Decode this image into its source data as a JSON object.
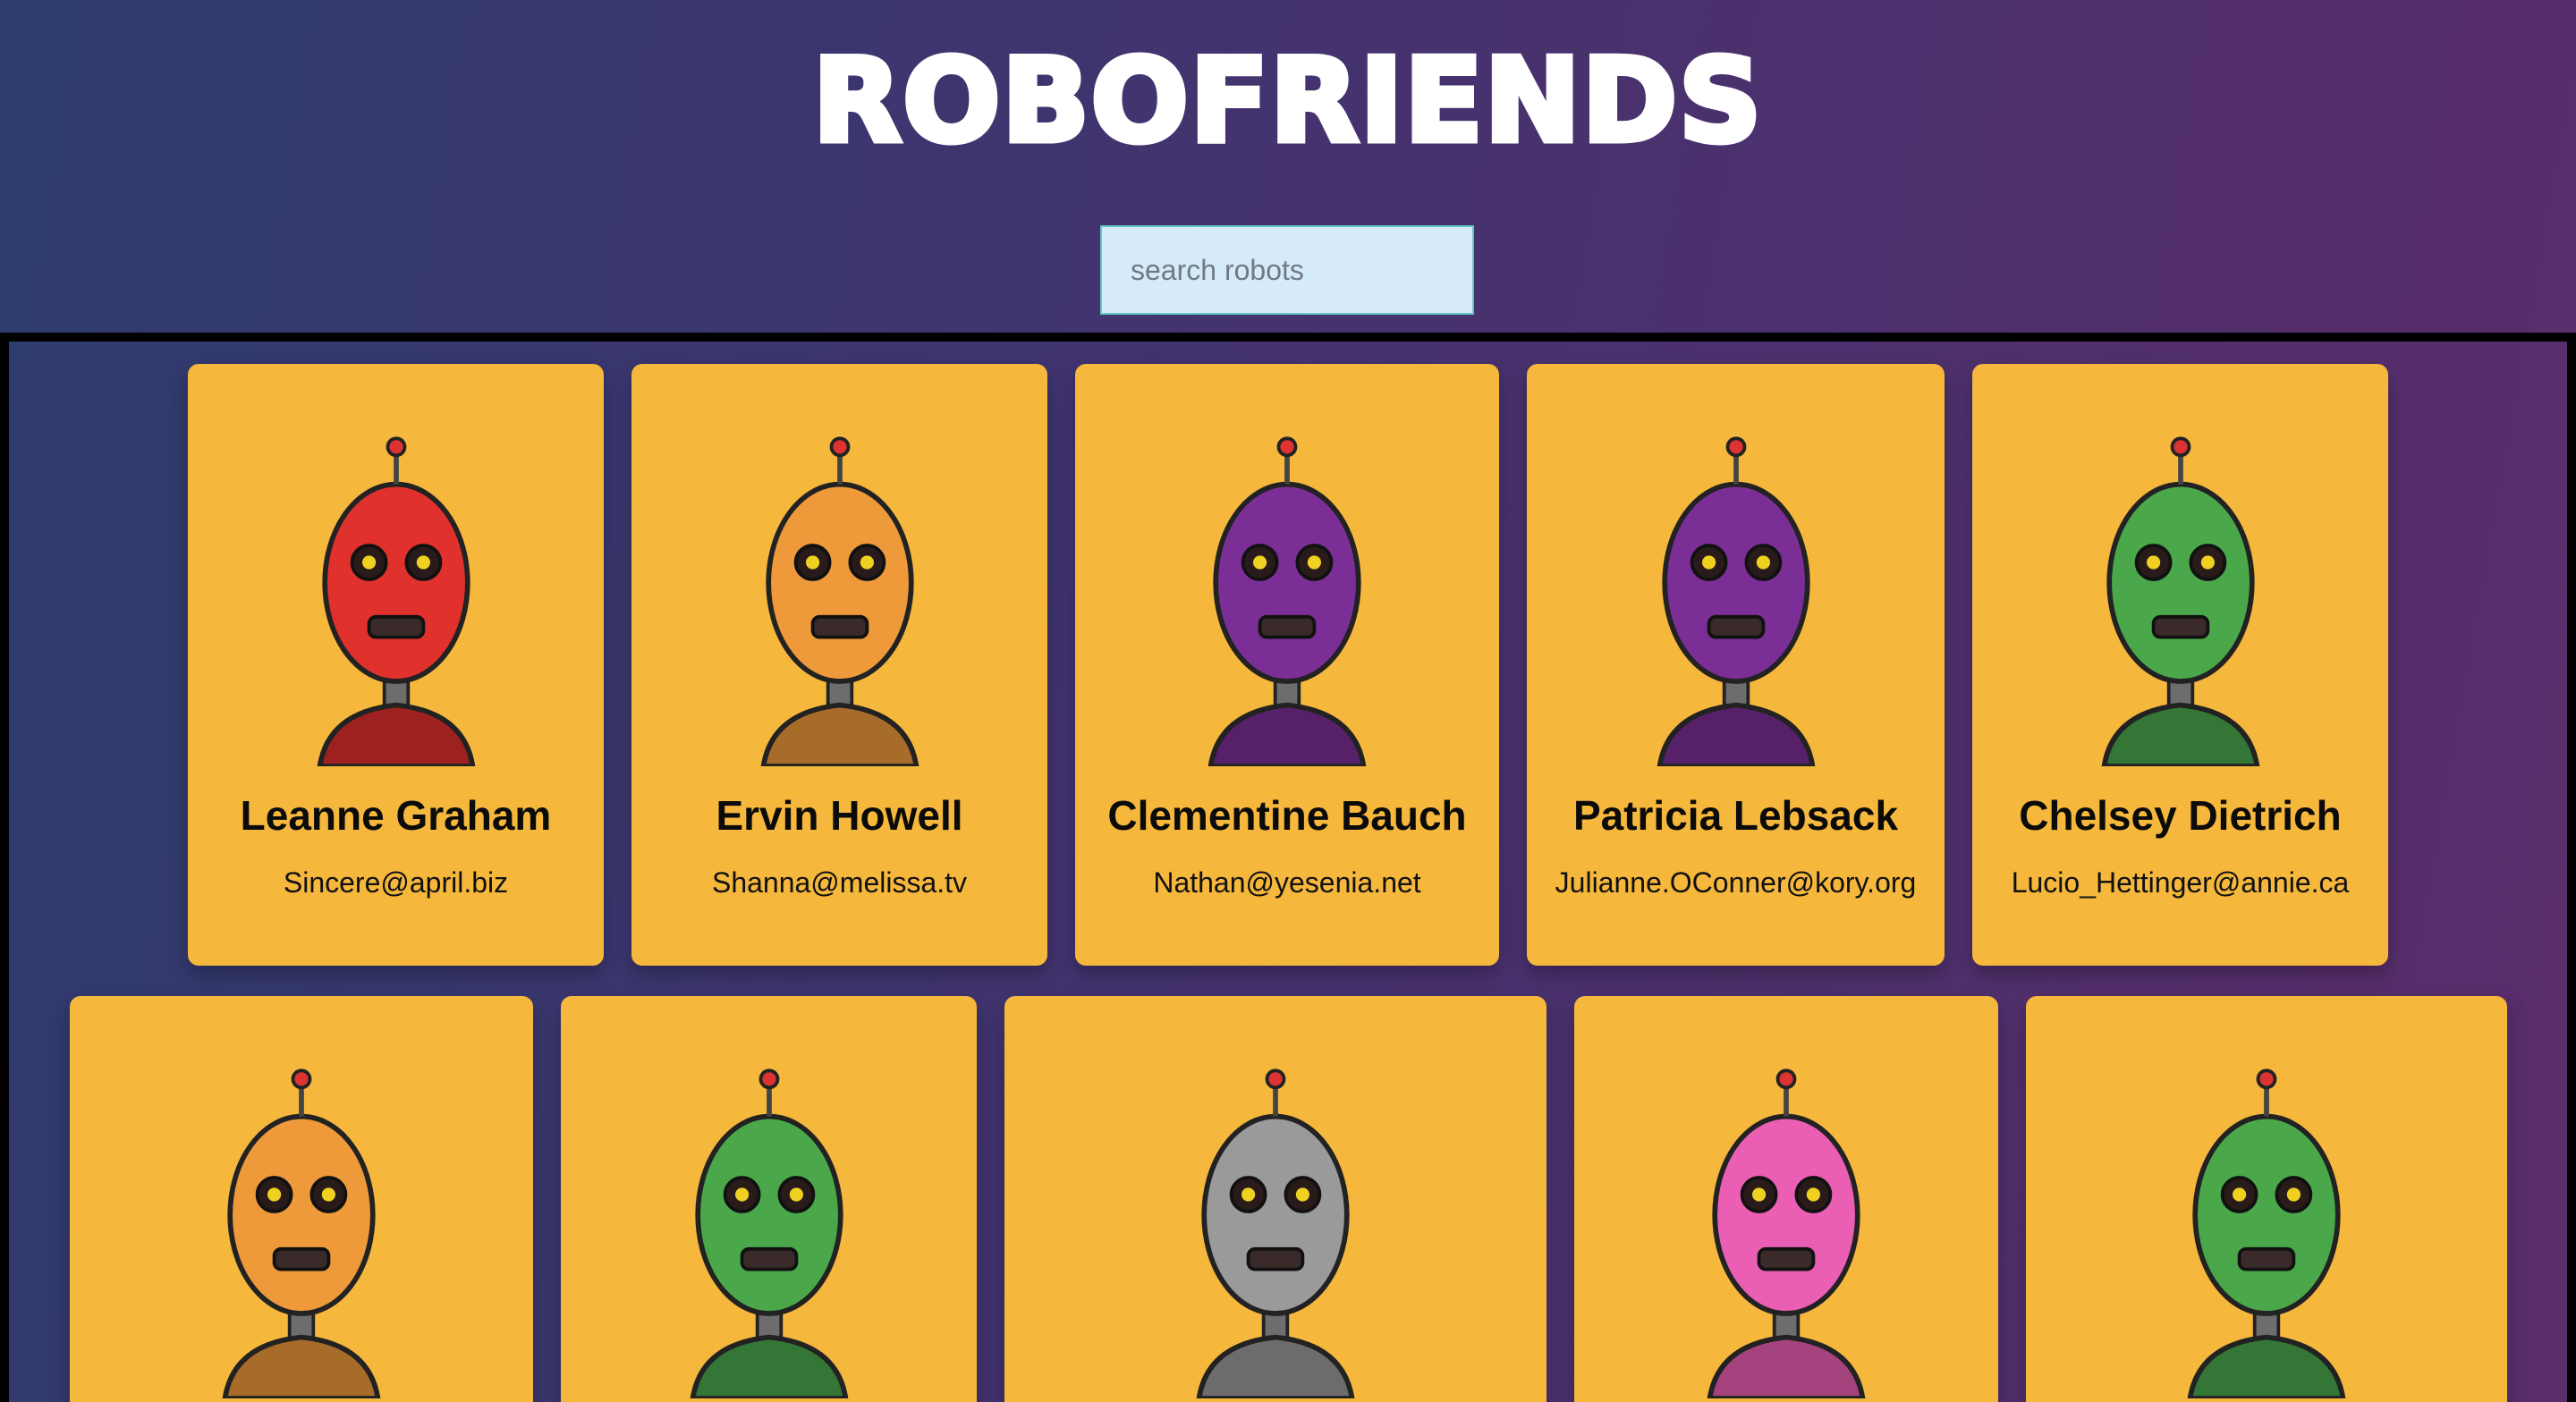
{
  "app": {
    "title": "ROBOFRIENDS"
  },
  "search": {
    "placeholder": "search robots",
    "value": ""
  },
  "colors": {
    "card_bg": "#f5b73c",
    "search_bg": "#d5ebfa",
    "search_border": "#64c9c4",
    "background_start": "#2e3c6e",
    "background_end": "#5b2d6b"
  },
  "robots": [
    {
      "name": "Leanne Graham",
      "email": "Sincere@april.biz",
      "color": "#e0312d",
      "icon": "red-robot-icon"
    },
    {
      "name": "Ervin Howell",
      "email": "Shanna@melissa.tv",
      "color": "#ee9a3a",
      "icon": "orange-robot-icon"
    },
    {
      "name": "Clementine Bauch",
      "email": "Nathan@yesenia.net",
      "color": "#7b2f96",
      "icon": "purple-robot-icon"
    },
    {
      "name": "Patricia Lebsack",
      "email": "Julianne.OConner@kory.org",
      "color": "#7b2f96",
      "icon": "purple-robot-icon"
    },
    {
      "name": "Chelsey Dietrich",
      "email": "Lucio_Hettinger@annie.ca",
      "color": "#4aa84b",
      "icon": "green-robot-icon"
    },
    {
      "name": "",
      "email": "",
      "color": "#ee9a3a",
      "icon": "orange-robot-icon"
    },
    {
      "name": "",
      "email": "",
      "color": "#4aa84b",
      "icon": "green-robot-icon"
    },
    {
      "name": "",
      "email": "",
      "color": "#9a9a9a",
      "icon": "gray-robot-icon"
    },
    {
      "name": "",
      "email": "",
      "color": "#ea5fb4",
      "icon": "pink-robot-icon"
    },
    {
      "name": "",
      "email": "",
      "color": "#4aa84b",
      "icon": "green-robot-icon"
    }
  ]
}
